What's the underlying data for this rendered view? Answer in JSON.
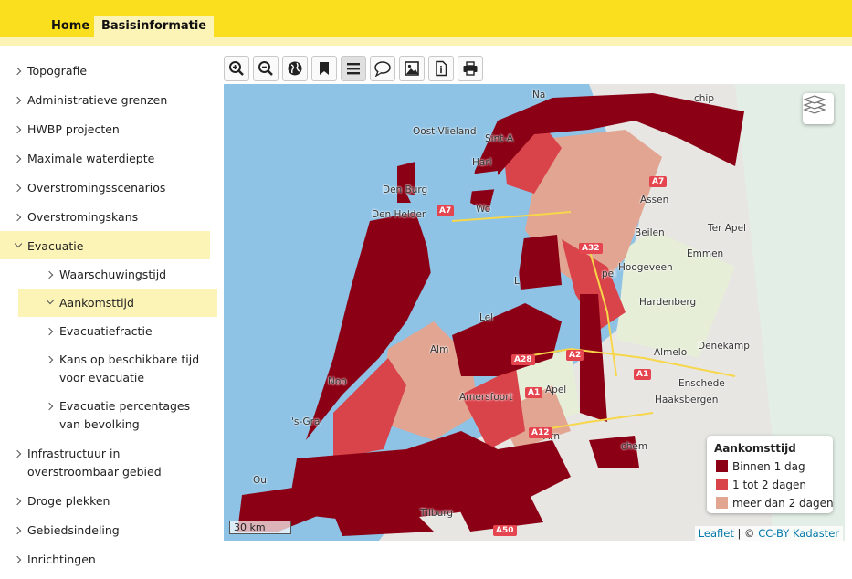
{
  "header": {
    "nav": [
      {
        "label": "Home"
      },
      {
        "label": "Basisinformatie"
      }
    ]
  },
  "sidebar": {
    "items": [
      {
        "label": "Topografie"
      },
      {
        "label": "Administratieve grenzen"
      },
      {
        "label": "HWBP projecten"
      },
      {
        "label": "Maximale waterdiepte"
      },
      {
        "label": "Overstromingsscenarios"
      },
      {
        "label": "Overstromingskans"
      },
      {
        "label": "Evacuatie"
      },
      {
        "label": "Waarschuwingstijd"
      },
      {
        "label": "Aankomsttijd"
      },
      {
        "label": "Evacuatiefractie"
      },
      {
        "label": "Kans op beschikbare tijd voor evacuatie"
      },
      {
        "label": "Evacuatie percentages van bevolking"
      },
      {
        "label": "Infrastructuur in overstroombaar gebied"
      },
      {
        "label": "Droge plekken"
      },
      {
        "label": "Gebiedsindeling"
      },
      {
        "label": "Inrichtingen"
      }
    ]
  },
  "toolbar": {
    "buttons": [
      "zoom-in-icon",
      "zoom-out-icon",
      "globe-icon",
      "bookmark-icon",
      "menu-icon",
      "comment-icon",
      "image-icon",
      "document-info-icon",
      "print-icon"
    ]
  },
  "map": {
    "cities": [
      "Oost-Vlieland",
      "Sint-A",
      "Harl",
      "Den Burg",
      "Den Helder",
      "Wo",
      "Assen",
      "Beilen",
      "Ter Apel",
      "Emmen",
      "Hoogeveen",
      "Hardenberg",
      "Almelo",
      "Denekamp",
      "Enschede",
      "Haaksbergen",
      "Lel",
      "Alm",
      "Noo",
      "'s-Gra",
      "Amersfoort",
      "Apel",
      "Arn",
      "Tilburg",
      "Ou",
      "Na",
      "chip",
      "chem",
      "pel",
      "L"
    ],
    "roads": [
      "A7",
      "A32",
      "A28",
      "A1",
      "A1",
      "A12",
      "A2",
      "A50",
      "A7"
    ],
    "scale_label": "30 km",
    "attribution": {
      "leaflet": "Leaflet",
      "sep": " | © ",
      "source": "CC-BY Kadaster"
    }
  },
  "legend": {
    "title": "Aankomsttijd",
    "items": [
      {
        "label": "Binnen 1 dag",
        "color": "#8b0015"
      },
      {
        "label": "1 tot 2 dagen",
        "color": "#d9434a"
      },
      {
        "label": "meer dan 2 dagen",
        "color": "#e1a592"
      }
    ]
  },
  "colors": {
    "accent": "#f9df1e",
    "accent_light": "#fcf4b6"
  }
}
